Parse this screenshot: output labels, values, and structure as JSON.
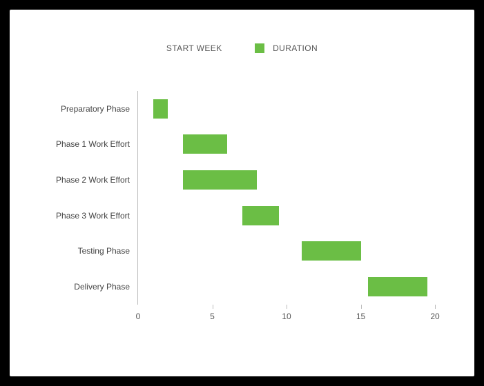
{
  "legend": {
    "start_week_label": "START WEEK",
    "duration_label": "DURATION"
  },
  "chart_data": {
    "type": "bar",
    "orientation": "horizontal",
    "stacked_floating": true,
    "categories": [
      "Preparatory Phase",
      "Phase 1 Work Effort",
      "Phase 2 Work Effort",
      "Phase 3 Work Effort",
      "Testing Phase",
      "Delivery Phase"
    ],
    "series": [
      {
        "name": "START WEEK",
        "values": [
          1,
          3,
          3,
          7,
          11,
          15.5
        ],
        "color": "transparent"
      },
      {
        "name": "DURATION",
        "values": [
          1,
          3,
          5,
          2.5,
          4,
          4
        ],
        "color": "#6bbe45"
      }
    ],
    "x_ticks": [
      0,
      5,
      10,
      15,
      20
    ],
    "xlim": [
      0,
      20
    ],
    "xlabel": "",
    "ylabel": "",
    "title": ""
  }
}
